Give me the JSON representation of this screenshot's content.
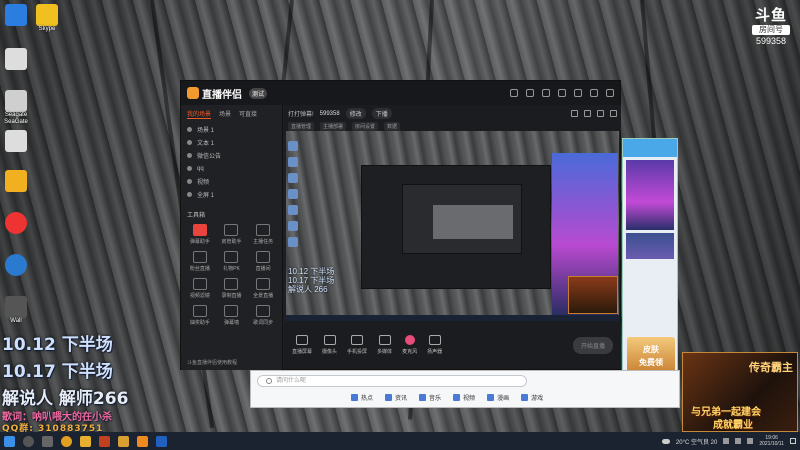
{
  "watermark": {
    "logo": "斗鱼",
    "sub": "房间号",
    "room_number": "599358"
  },
  "desktop_icons": [
    {
      "label": "",
      "color": "#2b7de0"
    },
    {
      "label": "Skype",
      "color": "#f0c020"
    },
    {
      "label": "",
      "color": "#ddd"
    },
    {
      "label": "Seagate SeaGate",
      "color": "#888"
    },
    {
      "label": "",
      "color": "#ddd"
    },
    {
      "label": "",
      "color": "#f0b020"
    },
    {
      "label": "",
      "color": "#e33"
    },
    {
      "label": "",
      "color": "#2a7ad0"
    },
    {
      "label": "Wall",
      "color": "#555"
    }
  ],
  "app": {
    "title": "直播伴侣",
    "badge": "测试",
    "left_tabs": [
      "我的场景",
      "场景",
      "可直接"
    ],
    "scenes": [
      "场景 1",
      "文本 1",
      "微信公告",
      "qq",
      "视频",
      "全屏 1"
    ],
    "tools_title": "工具箱",
    "tools": [
      "弹幕助手",
      "房管助手",
      "主播任务",
      "粉丝直播",
      "礼物PK",
      "直播间",
      "视频滤镜",
      "录制直播",
      "全景直播",
      "抽奖助手",
      "弹幕墙",
      "歌词同步"
    ],
    "footer": "斗鱼直播伴侣使用教程",
    "top": {
      "hint": "打打弹幕!",
      "room": "599358",
      "edit": "修改",
      "status": "下播",
      "r2": [
        "直播管理",
        "主播部署",
        "房间设置",
        "数据"
      ]
    },
    "bottom_tools": [
      "直播屏幕",
      "摄像头",
      "手机投屏",
      "多媒体",
      "麦克风",
      "扬声器"
    ],
    "start_button": "开始直播"
  },
  "preview_text": [
    "10.12 下半场",
    "10.17 下半场",
    "解说人 266"
  ],
  "overlay": {
    "line1": "10.12 下半场",
    "line2": "10.17 下半场",
    "line3": "解说人 解师266",
    "line4": "歌词：呐叭喂大的在小杀",
    "line5": "QQ群: 310883751"
  },
  "side": {
    "ad_line1": "皮肤",
    "ad_line2": "免费领"
  },
  "search": {
    "placeholder": "请问什么呢",
    "tabs": [
      "热点",
      "资讯",
      "音乐",
      "视频",
      "漫画",
      "游戏"
    ]
  },
  "game_ad": {
    "title": "传奇霸主",
    "line1": "与兄弟一起建会",
    "line2": "成就霸业"
  },
  "taskbar": {
    "weather": "20°C 空气良 20",
    "time": "19:06",
    "date": "2021/10/11"
  }
}
